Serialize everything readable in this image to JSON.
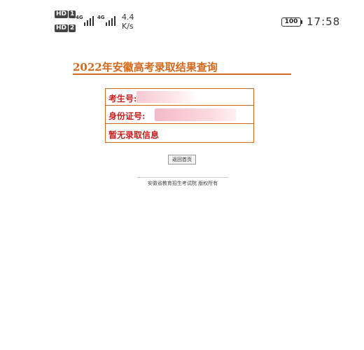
{
  "statusbar": {
    "sim1_hd": "HD",
    "sim1_num": "1",
    "sim2_hd": "HD",
    "sim2_num": "2",
    "net1_gen": "4G",
    "net2_gen": "4G",
    "speed_value": "4.4",
    "speed_unit": "K/s",
    "battery": "100",
    "time": "17:58",
    "icons": [
      "hd-icon",
      "signal-icon",
      "battery-icon"
    ]
  },
  "page": {
    "title": "2022年安徽高考录取结果查询",
    "accent_color": "#d2691e",
    "label_color": "#c81e1e",
    "result": {
      "exam_number_label": "考生号:",
      "id_number_label": "身份证号:",
      "status_text": "暂无录取信息"
    },
    "back_label": "返回首页",
    "footer": "安徽省教育招生考试院 版权所有"
  }
}
